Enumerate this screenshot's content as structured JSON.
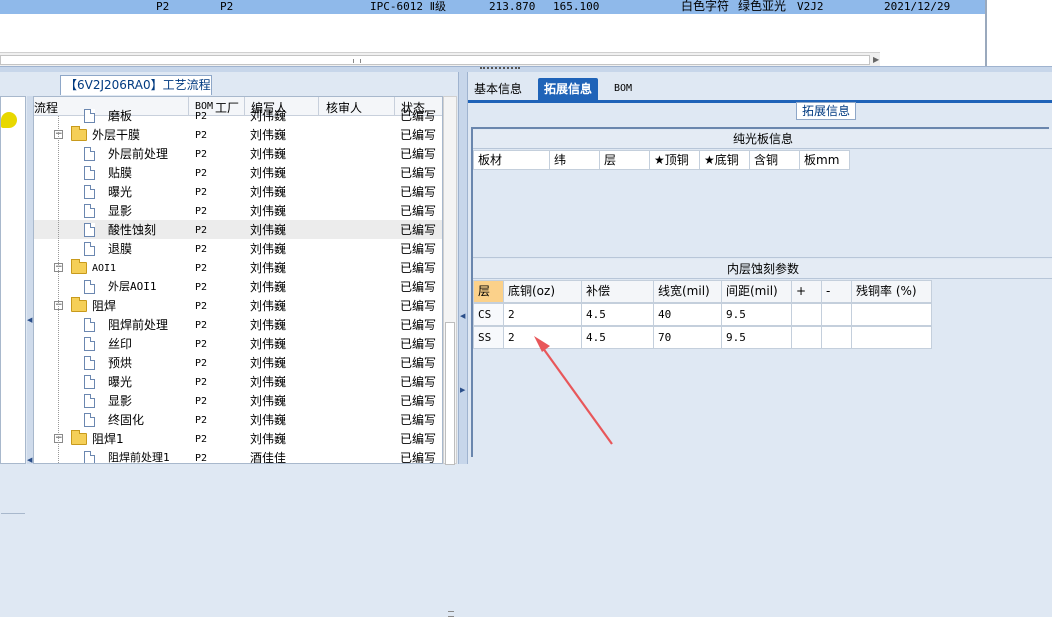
{
  "top_grid": {
    "row": {
      "c1": "P2",
      "c2": "P2",
      "model": "IPC-6012 Ⅱ级",
      "v1": "213.870",
      "v2": "165.100",
      "char_color": "白色字符",
      "mask": "绿色亚光",
      "ver": "V2J2",
      "date": "2021/12/29"
    }
  },
  "left_panel": {
    "tab_label": "【6V2J206RA0】工艺流程",
    "columns": {
      "flow": "流程",
      "bom": "BOM",
      "factory": "工厂",
      "author": "编写人",
      "reviewer": "核审人",
      "status": "状态"
    },
    "rows": [
      {
        "name": "磨板",
        "bom": "P2",
        "author": "刘伟巍",
        "status": "已编写",
        "type": "doc",
        "level": 2
      },
      {
        "name": "外层干膜",
        "bom": "P2",
        "author": "刘伟巍",
        "status": "已编写",
        "type": "folder",
        "level": 1
      },
      {
        "name": "外层前处理",
        "bom": "P2",
        "author": "刘伟巍",
        "status": "已编写",
        "type": "doc",
        "level": 2
      },
      {
        "name": "贴膜",
        "bom": "P2",
        "author": "刘伟巍",
        "status": "已编写",
        "type": "doc",
        "level": 2
      },
      {
        "name": "曝光",
        "bom": "P2",
        "author": "刘伟巍",
        "status": "已编写",
        "type": "doc",
        "level": 2
      },
      {
        "name": "显影",
        "bom": "P2",
        "author": "刘伟巍",
        "status": "已编写",
        "type": "doc",
        "level": 2
      },
      {
        "name": "酸性蚀刻",
        "bom": "P2",
        "author": "刘伟巍",
        "status": "已编写",
        "type": "doc",
        "level": 2,
        "selected": true
      },
      {
        "name": "退膜",
        "bom": "P2",
        "author": "刘伟巍",
        "status": "已编写",
        "type": "doc",
        "level": 2
      },
      {
        "name": "AOI1",
        "bom": "P2",
        "author": "刘伟巍",
        "status": "已编写",
        "type": "folder",
        "level": 1
      },
      {
        "name": "外层AOI1",
        "bom": "P2",
        "author": "刘伟巍",
        "status": "已编写",
        "type": "doc",
        "level": 2
      },
      {
        "name": "阻焊",
        "bom": "P2",
        "author": "刘伟巍",
        "status": "已编写",
        "type": "folder",
        "level": 1
      },
      {
        "name": "阻焊前处理",
        "bom": "P2",
        "author": "刘伟巍",
        "status": "已编写",
        "type": "doc",
        "level": 2
      },
      {
        "name": "丝印",
        "bom": "P2",
        "author": "刘伟巍",
        "status": "已编写",
        "type": "doc",
        "level": 2
      },
      {
        "name": "预烘",
        "bom": "P2",
        "author": "刘伟巍",
        "status": "已编写",
        "type": "doc",
        "level": 2
      },
      {
        "name": "曝光",
        "bom": "P2",
        "author": "刘伟巍",
        "status": "已编写",
        "type": "doc",
        "level": 2
      },
      {
        "name": "显影",
        "bom": "P2",
        "author": "刘伟巍",
        "status": "已编写",
        "type": "doc",
        "level": 2
      },
      {
        "name": "终固化",
        "bom": "P2",
        "author": "刘伟巍",
        "status": "已编写",
        "type": "doc",
        "level": 2
      },
      {
        "name": "阻焊1",
        "bom": "P2",
        "author": "刘伟巍",
        "status": "已编写",
        "type": "folder",
        "level": 1
      },
      {
        "name": "阻焊前处理1",
        "bom": "P2",
        "author": "酒佳佳",
        "status": "已编写",
        "type": "doc",
        "level": 2
      }
    ]
  },
  "right_panel": {
    "tabs": [
      "基本信息",
      "拓展信息",
      "BOM"
    ],
    "active_tab": 1,
    "group_label": "拓展信息",
    "section1": {
      "title": "纯光板信息",
      "columns": [
        "板材",
        "纬",
        "层",
        "★顶铜",
        "★底铜",
        "含铜",
        "板mm"
      ]
    },
    "section2": {
      "title": "内层蚀刻参数",
      "columns": [
        "层",
        "底铜(oz)",
        "补偿",
        "线宽(mil)",
        "间距(mil)",
        "+",
        "-",
        "残铜率 (%)"
      ],
      "rows": [
        [
          "CS",
          "2",
          "4.5",
          "40",
          "9.5",
          "",
          "",
          ""
        ],
        [
          "SS",
          "2",
          "4.5",
          "70",
          "9.5",
          "",
          "",
          ""
        ]
      ]
    },
    "annotation_color": "#e8575a"
  }
}
